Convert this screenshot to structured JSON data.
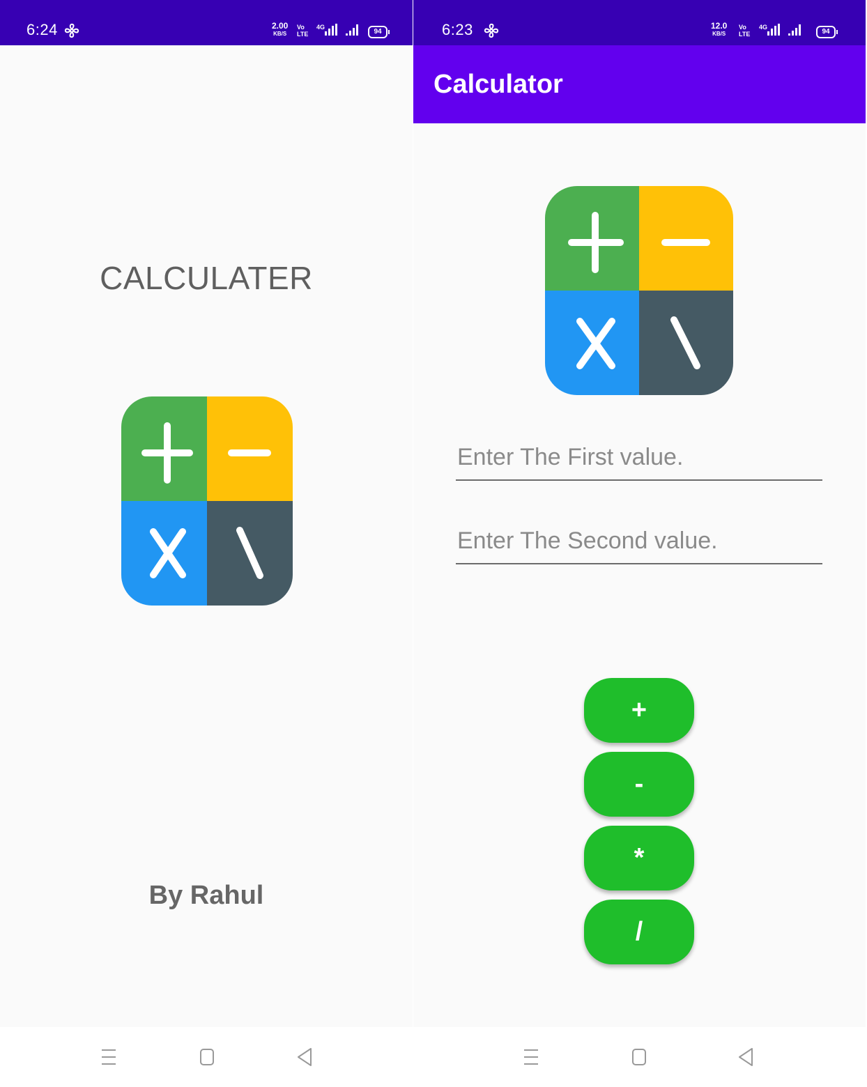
{
  "left_screen": {
    "status_bar": {
      "time": "6:24",
      "net_speed": "2.00",
      "net_unit": "KB/S",
      "volte": "Vo",
      "lte": "LTE",
      "net_type": "4G",
      "battery": "94"
    },
    "title": "CALCULATER",
    "author": "By Rahul"
  },
  "right_screen": {
    "status_bar": {
      "time": "6:23",
      "net_speed": "12.0",
      "net_unit": "KB/S",
      "volte": "Vo",
      "lte": "LTE",
      "net_type": "4G",
      "battery": "94"
    },
    "app_bar_title": "Calculator",
    "first_input": {
      "value": "",
      "placeholder": "Enter The First value."
    },
    "second_input": {
      "value": "",
      "placeholder": "Enter The Second value."
    },
    "buttons": [
      {
        "label": "+"
      },
      {
        "label": "-"
      },
      {
        "label": "*"
      },
      {
        "label": "/"
      }
    ]
  },
  "colors": {
    "status_bar": "#3700b3",
    "app_bar": "#6200ee",
    "button_green": "#1fbe2b",
    "logo_green": "#4caf50",
    "logo_yellow": "#ffc107",
    "logo_blue": "#2196f3",
    "logo_slate": "#455a64"
  },
  "icons": [
    "fan-icon",
    "signal-icon",
    "battery-icon",
    "calculator-logo-icon",
    "menu-icon",
    "home-icon",
    "back-icon"
  ]
}
